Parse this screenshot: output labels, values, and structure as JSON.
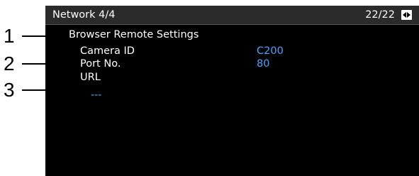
{
  "header": {
    "menu_title": "Network 4/4",
    "page_counter": "22/22",
    "scroll_icon": "left-right-arrows-icon"
  },
  "section": {
    "title": "Browser Remote Settings"
  },
  "rows": [
    {
      "label": "Camera ID",
      "value": "C200"
    },
    {
      "label": "Port No.",
      "value": "80"
    },
    {
      "label": "URL",
      "value": "---"
    }
  ],
  "callouts": [
    "1",
    "2",
    "3"
  ],
  "colors": {
    "screen_bg": "#000000",
    "header_bg": "#2b2b2b",
    "text": "#ffffff",
    "value": "#4aa3ff"
  }
}
